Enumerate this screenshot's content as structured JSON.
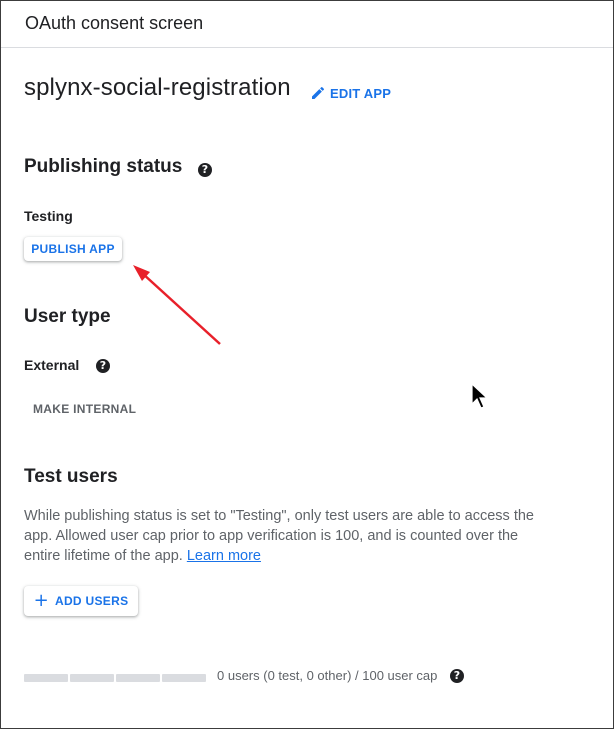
{
  "header": {
    "title": "OAuth consent screen"
  },
  "app": {
    "name": "splynx-social-registration",
    "edit_label": "EDIT APP"
  },
  "publishing": {
    "title": "Publishing status",
    "status": "Testing",
    "publish_label": "PUBLISH APP"
  },
  "user_type": {
    "title": "User type",
    "value": "External",
    "make_internal_label": "MAKE INTERNAL"
  },
  "test_users": {
    "title": "Test users",
    "description": "While publishing status is set to \"Testing\", only test users are able to access the app. Allowed user cap prior to app verification is 100, and is counted over the entire lifetime of the app.",
    "learn_more": "Learn more",
    "add_users_label": "ADD USERS",
    "cap_text": "0 users (0 test, 0 other) / 100 user cap",
    "cap_used_fraction": 0
  },
  "colors": {
    "accent": "#1a73e8",
    "annotation_arrow": "#e8202a"
  },
  "icons": {
    "edit": "pencil-icon",
    "help": "help-icon",
    "add": "plus-icon",
    "cursor": "mouse-cursor-icon"
  }
}
